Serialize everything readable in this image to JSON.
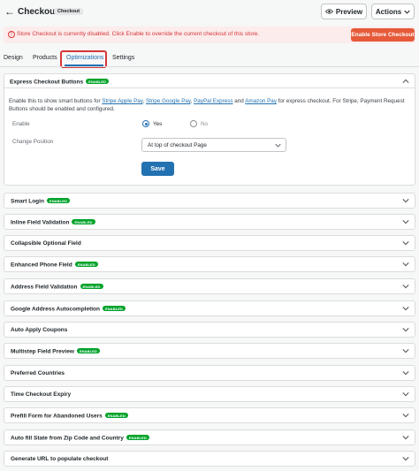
{
  "header": {
    "back_glyph": "←",
    "title": "Checkout",
    "badge": "Checkout",
    "preview_label": "Preview",
    "actions_label": "Actions"
  },
  "alert": {
    "text": "Store Checkout is currently disabled. Click Enable to override the current checkout of this store.",
    "button": "Enable Store Checkout"
  },
  "tabs": {
    "design": "Design",
    "products": "Products",
    "optimizations": "Optimizations",
    "settings": "Settings"
  },
  "express": {
    "title": "Express Checkout Buttons",
    "badge": "ENABLED",
    "desc_1": "Enable this to show smart buttons for ",
    "link_1": "Stripe Apple Pay",
    "sep_1": ", ",
    "link_2": "Stripe Google Pay",
    "sep_2": ", ",
    "link_3": "PayPal Express",
    "sep_3": " and ",
    "link_4": "Amazon Pay",
    "desc_2": " for express checkout. For Stripe, Payment Request Buttons should be enabled and configured.",
    "enable_label": "Enable",
    "yes": "Yes",
    "no": "No",
    "position_label": "Change Position",
    "position_value": "At top of checkout Page",
    "save": "Save"
  },
  "sections": [
    {
      "title": "Smart Login",
      "badge": "ENABLED"
    },
    {
      "title": "Inline Field Validation",
      "badge": "ENABLED"
    },
    {
      "title": "Collapsible Optional Field",
      "badge": ""
    },
    {
      "title": "Enhanced Phone Field",
      "badge": "ENABLED"
    },
    {
      "title": "Address Field Validation",
      "badge": "ENABLED"
    },
    {
      "title": "Google Address Autocompletion",
      "badge": "ENABLED"
    },
    {
      "title": "Auto Apply Coupons",
      "badge": ""
    },
    {
      "title": "Multistep Field Preview",
      "badge": "ENABLED"
    },
    {
      "title": "Preferred Countries",
      "badge": ""
    },
    {
      "title": "Time Checkout Expiry",
      "badge": ""
    },
    {
      "title": "Prefill Form for Abandoned Users",
      "badge": "ENABLED"
    },
    {
      "title": "Auto fill State from Zip Code and Country",
      "badge": "ENABLED"
    },
    {
      "title": "Generate URL to populate checkout",
      "badge": ""
    }
  ],
  "colors": {
    "accent": "#2271b1",
    "enabled": "#00a32a",
    "alert": "#d63638",
    "alert_button": "#e65a3a"
  }
}
